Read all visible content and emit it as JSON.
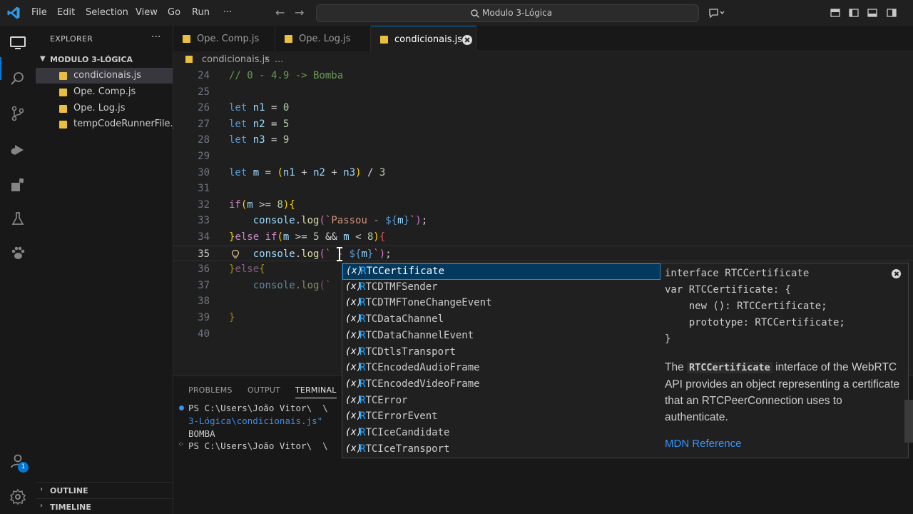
{
  "titlebar": {
    "menu": [
      "File",
      "Edit",
      "Selection",
      "View",
      "Go",
      "Run",
      "···"
    ],
    "search_text": "Modulo 3-Lógica"
  },
  "activity": {
    "items": [
      "explorer-icon",
      "search-icon",
      "source-control-icon",
      "run-debug-icon",
      "extensions-icon",
      "testing-icon",
      "remote-icon"
    ],
    "accounts_badge": "1",
    "accent": "#0078d4"
  },
  "sidebar": {
    "title": "EXPLORER",
    "more": "···",
    "folder": "MODULO 3-LÓGICA",
    "files": [
      "condicionais.js",
      "Ope. Comp.js",
      "Ope. Log.js",
      "tempCodeRunnerFile.js"
    ],
    "outline": "OUTLINE",
    "timeline": "TIMELINE"
  },
  "tabs": [
    "Ope. Comp.js",
    "Ope. Log.js",
    "condicionais.js"
  ],
  "breadcrumb": {
    "file": "condicionais.js",
    "sep": "›",
    "more": "..."
  },
  "editor": {
    "line_numbers": [
      "24",
      "25",
      "26",
      "27",
      "28",
      "29",
      "30",
      "31",
      "32",
      "33",
      "34",
      "35",
      "36",
      "37",
      "38",
      "39",
      "40"
    ]
  },
  "panel": {
    "tabs": [
      "PROBLEMS",
      "OUTPUT",
      "TERMINAL"
    ],
    "lines": [
      "PS C:\\Users\\João Vitor\\  \\",
      "3-Lógica\\condicionais.js\"",
      "BOMBA",
      "PS C:\\Users\\João Vitor\\  \\"
    ]
  },
  "suggest": {
    "icon": "(x)",
    "items": [
      {
        "prefix": "R",
        "rest": "TCCertificate"
      },
      {
        "prefix": "R",
        "rest": "TCDTMFSender"
      },
      {
        "prefix": "R",
        "rest": "TCDTMFToneChangeEvent"
      },
      {
        "prefix": "R",
        "rest": "TCDataChannel"
      },
      {
        "prefix": "R",
        "rest": "TCDataChannelEvent"
      },
      {
        "prefix": "R",
        "rest": "TCDtlsTransport"
      },
      {
        "prefix": "R",
        "rest": "TCEncodedAudioFrame"
      },
      {
        "prefix": "R",
        "rest": "TCEncodedVideoFrame"
      },
      {
        "prefix": "R",
        "rest": "TCError"
      },
      {
        "prefix": "R",
        "rest": "TCErrorEvent"
      },
      {
        "prefix": "R",
        "rest": "TCIceCandidate"
      },
      {
        "prefix": "R",
        "rest": "TCIceTransport"
      }
    ]
  },
  "details": {
    "code_lines": [
      "interface RTCCertificate",
      "var RTCCertificate: {",
      "    new (): RTCCertificate;",
      "    prototype: RTCCertificate;",
      "}"
    ],
    "desc_before": "The ",
    "desc_bold": "RTCCertificate",
    "desc_after": " interface of the WebRTC API provides an object representing a certificate that an RTCPeerConnection uses to authenticate.",
    "link": "MDN Reference"
  }
}
